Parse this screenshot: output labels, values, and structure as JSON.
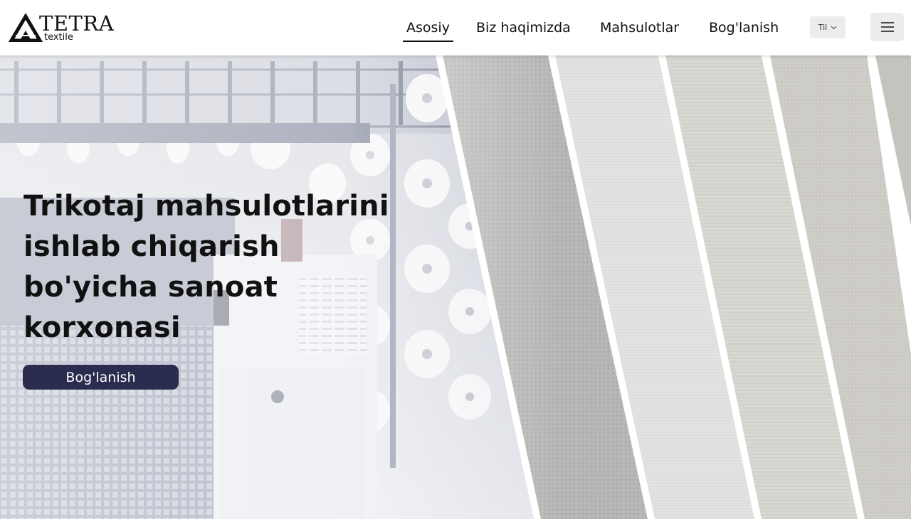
{
  "brand": {
    "name": "TETRA",
    "tagline": "textile"
  },
  "nav": {
    "items": [
      {
        "label": "Asosiy",
        "active": true
      },
      {
        "label": "Biz haqimizda",
        "active": false
      },
      {
        "label": "Mahsulotlar",
        "active": false
      },
      {
        "label": "Bog'lanish",
        "active": false
      }
    ],
    "language_label": "Til",
    "language_icon": "chevron-down-icon",
    "menu_icon": "hamburger-menu-icon"
  },
  "hero": {
    "title": "Trikotaj mahsulotlarini ishlab chiqarish bo'yicha sanoat korxonasi",
    "cta_label": "Bog'lanish",
    "image": "knitting-machines-and-fabric-swatches"
  },
  "colors": {
    "accent": "#2b2d4f",
    "header_bg": "#ffffff",
    "control_bg": "#ececec",
    "text": "#111111"
  }
}
